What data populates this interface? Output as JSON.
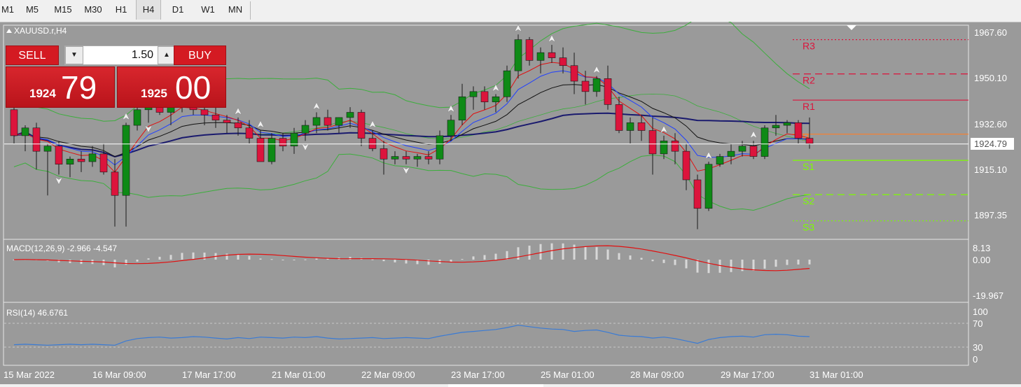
{
  "toolbar": {
    "timeframes": [
      "M1",
      "M5",
      "M15",
      "M30",
      "H1",
      "H4",
      "D1",
      "W1",
      "MN"
    ],
    "active": "H4"
  },
  "chart": {
    "title": "XAUUSD.r,H4",
    "price_labels": [
      "1967.60",
      "1950.10",
      "1932.60",
      "1924.79",
      "1915.10",
      "1897.35"
    ],
    "current_price": "1924.79",
    "pivots": [
      {
        "name": "R3",
        "color": "#dc143c",
        "style": "dotted"
      },
      {
        "name": "R2",
        "color": "#dc143c",
        "style": "dashed"
      },
      {
        "name": "R1",
        "color": "#dc143c",
        "style": "solid"
      },
      {
        "name": "P",
        "color": "#ff7f27",
        "style": "solid"
      },
      {
        "name": "S1",
        "color": "#7cfc00",
        "style": "solid"
      },
      {
        "name": "S2",
        "color": "#7cfc00",
        "style": "dashed"
      },
      {
        "name": "S3",
        "color": "#7cfc00",
        "style": "dotted"
      }
    ],
    "pivot_values": [
      1965.0,
      1951.8,
      1941.7,
      1928.6,
      1918.5,
      1905.3,
      1895.2
    ],
    "candles": [
      [
        1938,
        1945,
        1925,
        1928
      ],
      [
        1928,
        1932,
        1922,
        1931
      ],
      [
        1931,
        1933,
        1915,
        1922
      ],
      [
        1922,
        1925,
        1905,
        1924
      ],
      [
        1924,
        1926,
        1913,
        1917
      ],
      [
        1917,
        1920,
        1912,
        1919
      ],
      [
        1919,
        1922,
        1914,
        1918
      ],
      [
        1918,
        1924,
        1916,
        1921
      ],
      [
        1921,
        1925,
        1913,
        1914
      ],
      [
        1914,
        1919,
        1893,
        1905
      ],
      [
        1905,
        1933,
        1893,
        1932
      ],
      [
        1932,
        1940,
        1930,
        1938
      ],
      [
        1938,
        1944,
        1933,
        1943
      ],
      [
        1943,
        1946,
        1936,
        1937
      ],
      [
        1937,
        1941,
        1932,
        1941
      ],
      [
        1941,
        1947,
        1937,
        1945
      ],
      [
        1945,
        1946,
        1936,
        1938
      ],
      [
        1938,
        1942,
        1932,
        1936
      ],
      [
        1936,
        1939,
        1931,
        1934
      ],
      [
        1934,
        1936,
        1929,
        1933
      ],
      [
        1933,
        1935,
        1928,
        1931
      ],
      [
        1931,
        1934,
        1925,
        1927
      ],
      [
        1927,
        1930,
        1921,
        1918
      ],
      [
        1918,
        1929,
        1917,
        1927
      ],
      [
        1927,
        1929,
        1922,
        1924
      ],
      [
        1924,
        1931,
        1921,
        1929
      ],
      [
        1929,
        1934,
        1926,
        1932
      ],
      [
        1932,
        1937,
        1929,
        1935
      ],
      [
        1935,
        1938,
        1930,
        1932
      ],
      [
        1932,
        1935,
        1929,
        1935
      ],
      [
        1935,
        1939,
        1931,
        1937
      ],
      [
        1937,
        1938,
        1924,
        1927
      ],
      [
        1927,
        1930,
        1922,
        1923
      ],
      [
        1923,
        1926,
        1913,
        1919
      ],
      [
        1919,
        1922,
        1917,
        1920
      ],
      [
        1920,
        1922,
        1917,
        1919
      ],
      [
        1919,
        1921,
        1916,
        1920
      ],
      [
        1920,
        1922,
        1917,
        1919
      ],
      [
        1919,
        1930,
        1917,
        1928
      ],
      [
        1928,
        1936,
        1926,
        1934
      ],
      [
        1934,
        1948,
        1932,
        1943
      ],
      [
        1943,
        1947,
        1938,
        1945
      ],
      [
        1945,
        1947,
        1938,
        1941
      ],
      [
        1941,
        1944,
        1937,
        1943
      ],
      [
        1943,
        1955,
        1941,
        1953
      ],
      [
        1953,
        1967,
        1950,
        1965
      ],
      [
        1965,
        1966,
        1955,
        1957
      ],
      [
        1957,
        1962,
        1952,
        1960
      ],
      [
        1960,
        1963,
        1956,
        1958
      ],
      [
        1958,
        1962,
        1952,
        1955
      ],
      [
        1955,
        1960,
        1944,
        1949
      ],
      [
        1949,
        1953,
        1940,
        1945
      ],
      [
        1945,
        1951,
        1943,
        1950
      ],
      [
        1950,
        1955,
        1938,
        1940
      ],
      [
        1940,
        1943,
        1929,
        1930
      ],
      [
        1930,
        1935,
        1925,
        1933
      ],
      [
        1933,
        1936,
        1926,
        1930
      ],
      [
        1930,
        1935,
        1913,
        1921
      ],
      [
        1921,
        1928,
        1919,
        1926
      ],
      [
        1926,
        1929,
        1917,
        1922
      ],
      [
        1922,
        1925,
        1907,
        1911
      ],
      [
        1911,
        1913,
        1892,
        1900
      ],
      [
        1900,
        1918,
        1899,
        1917
      ],
      [
        1917,
        1921,
        1916,
        1920
      ],
      [
        1920,
        1925,
        1917,
        1922
      ],
      [
        1922,
        1926,
        1920,
        1924
      ],
      [
        1924,
        1926,
        1919,
        1920
      ],
      [
        1920,
        1932,
        1919,
        1931
      ],
      [
        1931,
        1936,
        1928,
        1932
      ],
      [
        1932,
        1934,
        1929,
        1933
      ],
      [
        1933,
        1934,
        1925,
        1927
      ],
      [
        1927,
        1935,
        1923,
        1925
      ]
    ],
    "buy_arrows": [
      10,
      20,
      22,
      27,
      32,
      39,
      43,
      45,
      48,
      52,
      58,
      62,
      66
    ],
    "sell_arrows": [
      4,
      12,
      26,
      35
    ],
    "date_labels": [
      "15 Mar 2022",
      "16 Mar 09:00",
      "17 Mar 17:00",
      "21 Mar 01:00",
      "22 Mar 09:00",
      "23 Mar 17:00",
      "25 Mar 01:00",
      "28 Mar 09:00",
      "29 Mar 17:00",
      "31 Mar 01:00"
    ]
  },
  "trade_panel": {
    "sell_label": "SELL",
    "buy_label": "BUY",
    "lot": "1.50",
    "sell_price_small": "1924",
    "sell_price_big": "79",
    "buy_price_small": "1925",
    "buy_price_big": "00"
  },
  "macd": {
    "title": "MACD(12,26,9) -2.966 -4.547",
    "scale_labels": [
      "8.13",
      "0.00",
      "-19.967"
    ]
  },
  "rsi": {
    "title": "RSI(14) 46.6761",
    "scale_labels": [
      "100",
      "70",
      "30",
      "0"
    ],
    "values": [
      30,
      31,
      30,
      29,
      30,
      31,
      30,
      31,
      30,
      29,
      38,
      43,
      45,
      46,
      44,
      45,
      47,
      46,
      44,
      42,
      45,
      43,
      46,
      45,
      44,
      46,
      45,
      47,
      44,
      42,
      43,
      44,
      45,
      43,
      44,
      45,
      44,
      43,
      48,
      52,
      56,
      58,
      60,
      62,
      66,
      71,
      68,
      65,
      63,
      62,
      58,
      60,
      61,
      56,
      50,
      48,
      47,
      44,
      46,
      43,
      38,
      33,
      41,
      45,
      47,
      48,
      46,
      51,
      52,
      51,
      48,
      47
    ]
  },
  "colors": {
    "bg": "#9a9a9a",
    "bull": "#0e8a16",
    "bear": "#dc143c",
    "ma_navy": "#1a1a6e",
    "ma_black": "#111111",
    "ma_blue": "#1f3fff",
    "ma_red": "#e01010",
    "bollinger": "#3cae3c",
    "rsi_line": "#3a7bd5"
  }
}
